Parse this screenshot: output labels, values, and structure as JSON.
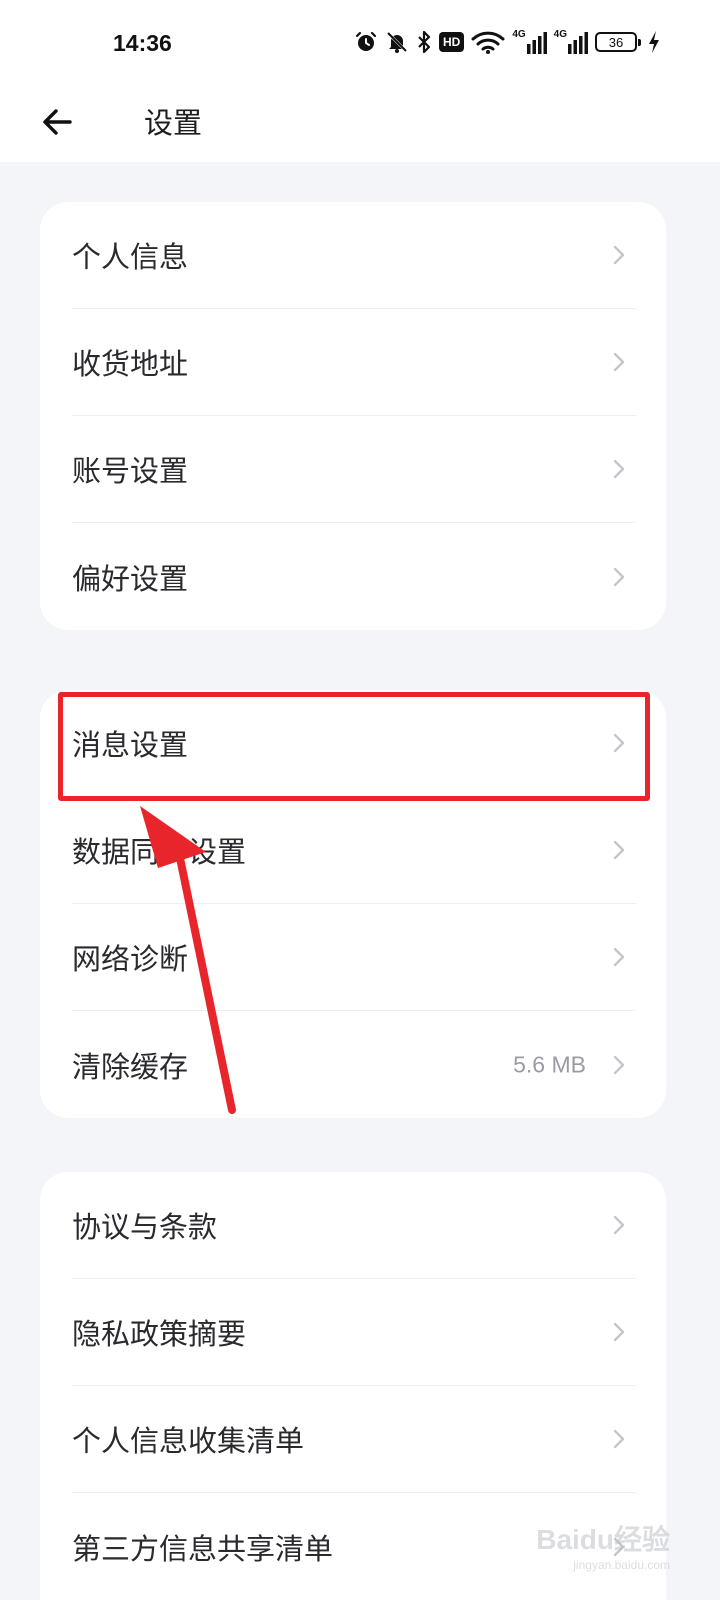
{
  "status_bar": {
    "time": "14:36",
    "icons": [
      "alarm-icon",
      "bell-muted-icon",
      "bluetooth-icon",
      "hd-icon",
      "wifi-icon",
      "signal-4g-icon",
      "signal-4g-icon",
      "battery-icon",
      "charging-icon"
    ],
    "hd_label": "HD",
    "network_label": "4G",
    "battery_level": "36"
  },
  "header": {
    "title": "设置",
    "back_icon": "arrow-left-icon"
  },
  "groups": [
    {
      "items": [
        {
          "label": "个人信息"
        },
        {
          "label": "收货地址"
        },
        {
          "label": "账号设置"
        },
        {
          "label": "偏好设置"
        }
      ]
    },
    {
      "items": [
        {
          "label": "消息设置"
        },
        {
          "label": "数据同步设置"
        },
        {
          "label": "网络诊断"
        },
        {
          "label": "清除缓存",
          "value": "5.6 MB"
        }
      ]
    },
    {
      "items": [
        {
          "label": "协议与条款"
        },
        {
          "label": "隐私政策摘要"
        },
        {
          "label": "个人信息收集清单"
        },
        {
          "label": "第三方信息共享清单"
        }
      ]
    }
  ],
  "annotation": {
    "highlighted_item": "消息设置",
    "color": "#e8252a"
  },
  "watermark": {
    "text": "Baidu经验",
    "sub": "jingyan.baidu.com"
  },
  "colors": {
    "background": "#f4f5f9",
    "card": "#ffffff",
    "label": "#2a2a2e",
    "secondary": "#9a9ca3",
    "chevron": "#c4c6cc"
  }
}
